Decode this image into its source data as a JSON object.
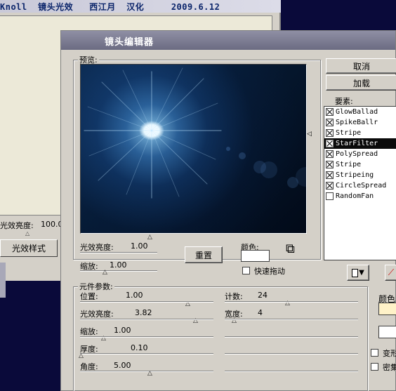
{
  "bg_window": {
    "title": "Knoll  镜头光效   西江月  汉化     2009.6.12",
    "luminance_label": "光效亮度:",
    "luminance_value": "100.0",
    "style_button": "光效样式"
  },
  "dialog": {
    "title": "镜头编辑器",
    "preview_label": "预览:",
    "preview": {
      "luminance_label": "光效亮度:",
      "luminance_value": "1.00",
      "scale_label": "缩放:",
      "scale_value": "1.00",
      "reset_button": "重置",
      "color_label": "颜色:",
      "fast_drag_label": "快速拖动"
    },
    "buttons": {
      "cancel": "取消",
      "load": "加载"
    },
    "elements_label": "要素:",
    "elements": [
      {
        "name": "GlowBallad",
        "checked": true,
        "selected": false
      },
      {
        "name": "SpikeBallr",
        "checked": true,
        "selected": false
      },
      {
        "name": "Stripe",
        "checked": true,
        "selected": false
      },
      {
        "name": "StarFilter",
        "checked": true,
        "selected": true
      },
      {
        "name": "PolySpread",
        "checked": true,
        "selected": false
      },
      {
        "name": "Stripe",
        "checked": true,
        "selected": false
      },
      {
        "name": "Stripeing",
        "checked": true,
        "selected": false
      },
      {
        "name": "CircleSpread",
        "checked": true,
        "selected": false
      },
      {
        "name": "RandomFan",
        "checked": false,
        "selected": false
      }
    ],
    "params": {
      "label": "元件参数:",
      "position_label": "位置:",
      "position_value": "1.00",
      "luminance_label": "光效亮度:",
      "luminance_value": "3.82",
      "scale_label": "缩放:",
      "scale_value": "1.00",
      "thickness_label": "厚度:",
      "thickness_value": "0.10",
      "angle_label": "角度:",
      "angle_value": "5.00",
      "count_label": "计数:",
      "count_value": "24",
      "width_label": "宽度:",
      "width_value": "4",
      "color_label": "颜色",
      "check1_label": "变形",
      "check2_label": "密集"
    },
    "accent_colors": {
      "selection": "#0a0a0a",
      "element_color": "#fff2c8"
    }
  }
}
